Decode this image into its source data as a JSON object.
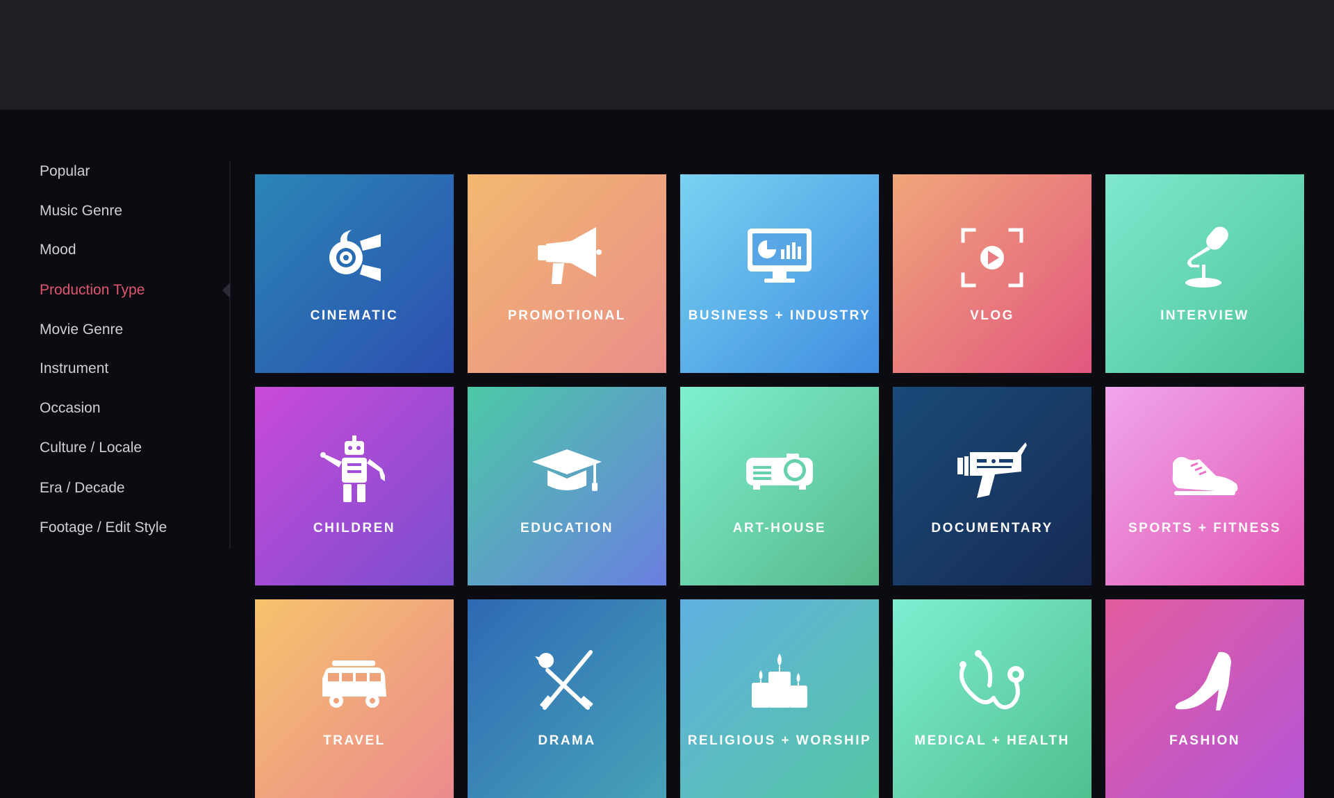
{
  "sidebar": {
    "items": [
      {
        "label": "Popular"
      },
      {
        "label": "Music Genre"
      },
      {
        "label": "Mood"
      },
      {
        "label": "Production Type"
      },
      {
        "label": "Movie Genre"
      },
      {
        "label": "Instrument"
      },
      {
        "label": "Occasion"
      },
      {
        "label": "Culture / Locale"
      },
      {
        "label": "Era / Decade"
      },
      {
        "label": "Footage / Edit Style"
      }
    ],
    "active_index": 3,
    "active_color": "#e0566f"
  },
  "tiles": [
    {
      "label": "CINEMATIC",
      "icon": "spotlight-icon",
      "colors": [
        "#2a86b5",
        "#2c4fb0"
      ]
    },
    {
      "label": "PROMOTIONAL",
      "icon": "megaphone-icon",
      "colors": [
        "#f3b870",
        "#e98e8a"
      ]
    },
    {
      "label": "BUSINESS + INDUSTRY",
      "icon": "monitor-chart-icon",
      "colors": [
        "#79d3f1",
        "#3f8de0"
      ]
    },
    {
      "label": "VLOG",
      "icon": "camera-frame-play-icon",
      "colors": [
        "#f0a67a",
        "#e2577f"
      ]
    },
    {
      "label": "INTERVIEW",
      "icon": "microphone-icon",
      "colors": [
        "#7fe8cd",
        "#4cc39a"
      ]
    },
    {
      "label": "CHILDREN",
      "icon": "robot-icon",
      "colors": [
        "#c94ad8",
        "#7a4ed0"
      ]
    },
    {
      "label": "EDUCATION",
      "icon": "graduation-cap-icon",
      "colors": [
        "#4cc9a6",
        "#6a7fe0"
      ]
    },
    {
      "label": "ART-HOUSE",
      "icon": "projector-icon",
      "colors": [
        "#7ff0cf",
        "#56b88a"
      ]
    },
    {
      "label": "DOCUMENTARY",
      "icon": "video-camera-icon",
      "colors": [
        "#1a4a78",
        "#162a54"
      ]
    },
    {
      "label": "SPORTS + FITNESS",
      "icon": "sneaker-icon",
      "colors": [
        "#f0a5ec",
        "#e258b2"
      ]
    },
    {
      "label": "TRAVEL",
      "icon": "camper-van-icon",
      "colors": [
        "#f6c36c",
        "#ec8a8e"
      ]
    },
    {
      "label": "DRAMA",
      "icon": "crossed-swords-rose-icon",
      "colors": [
        "#2d69b4",
        "#47a3b8"
      ]
    },
    {
      "label": "RELIGIOUS + WORSHIP",
      "icon": "candles-icon",
      "colors": [
        "#5fb0e0",
        "#56c6a4"
      ]
    },
    {
      "label": "MEDICAL + HEALTH",
      "icon": "stethoscope-icon",
      "colors": [
        "#7feed1",
        "#4fbf8e"
      ]
    },
    {
      "label": "FASHION",
      "icon": "high-heel-icon",
      "colors": [
        "#e25c9e",
        "#b656d8"
      ]
    }
  ]
}
